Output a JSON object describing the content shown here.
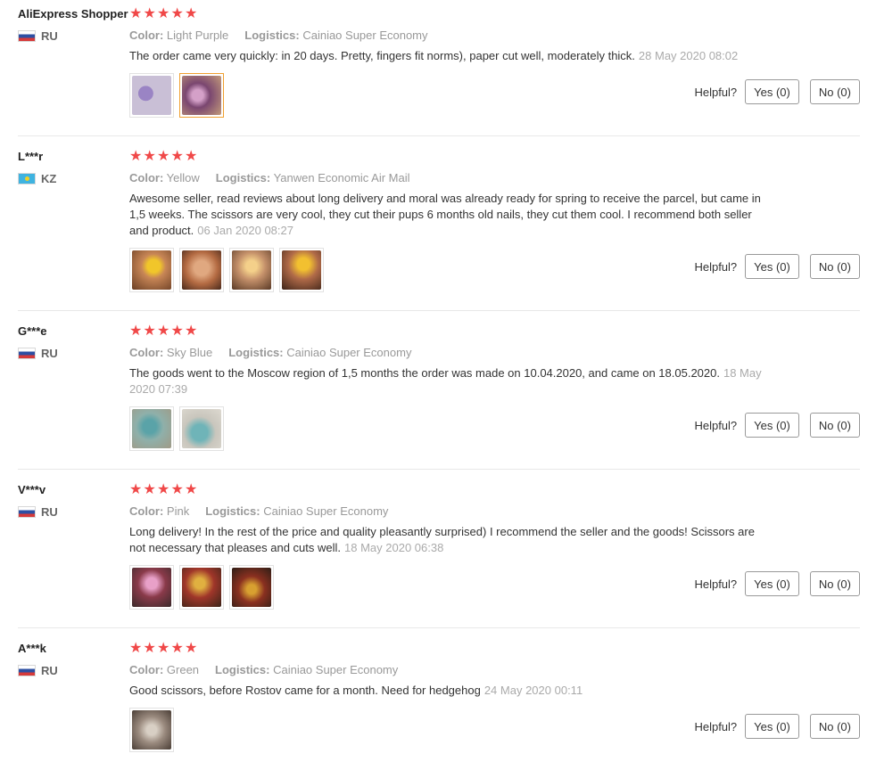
{
  "reviews": [
    {
      "user": "AliExpress Shopper",
      "country": "RU",
      "flag": "ru",
      "stars": 5,
      "color_label": "Color:",
      "color_value": "Light Purple",
      "logistics_label": "Logistics:",
      "logistics_value": "Cainiao Super Economy",
      "text": "The order came very quickly: in 20 days. Pretty, fingers fit norms), paper cut well, moderately thick.",
      "date": "28 May 2020 08:02",
      "photo_colors": [
        "#b9a8cf",
        "#9c6fb0"
      ],
      "helpful_label": "Helpful?",
      "yes_label": "Yes (0)",
      "no_label": "No (0)"
    },
    {
      "user": "L***r",
      "country": "KZ",
      "flag": "kz",
      "stars": 5,
      "color_label": "Color:",
      "color_value": "Yellow",
      "logistics_label": "Logistics:",
      "logistics_value": "Yanwen Economic Air Mail",
      "text": "Awesome seller, read reviews about long delivery and moral was already ready for spring to receive the parcel, but came in 1,5 weeks. The scissors are very cool, they cut their pups 6 months old nails, they cut them cool. I recommend both seller and product.",
      "date": "06 Jan 2020 08:27",
      "photo_colors": [
        "#c87a3c",
        "#c9844e",
        "#b97a4a",
        "#8a5a3c"
      ],
      "helpful_label": "Helpful?",
      "yes_label": "Yes (0)",
      "no_label": "No (0)"
    },
    {
      "user": "G***e",
      "country": "RU",
      "flag": "ru",
      "stars": 5,
      "color_label": "Color:",
      "color_value": "Sky Blue",
      "logistics_label": "Logistics:",
      "logistics_value": "Cainiao Super Economy",
      "text": "The goods went to the Moscow region of 1,5 months the order was made on 10.04.2020, and came on 18.05.2020.",
      "date": "18 May 2020 07:39",
      "photo_colors": [
        "#6f9e96",
        "#7faaa3"
      ],
      "helpful_label": "Helpful?",
      "yes_label": "Yes (0)",
      "no_label": "No (0)"
    },
    {
      "user": "V***v",
      "country": "RU",
      "flag": "ru",
      "stars": 5,
      "color_label": "Color:",
      "color_value": "Pink",
      "logistics_label": "Logistics:",
      "logistics_value": "Cainiao Super Economy",
      "text": "Long delivery! In the rest of the price and quality pleasantly surprised) I recommend the seller and the goods! Scissors are not necessary that pleases and cuts well.",
      "date": "18 May 2020 06:38",
      "photo_colors": [
        "#8a3a4a",
        "#9a3c36",
        "#7a3a2c"
      ],
      "helpful_label": "Helpful?",
      "yes_label": "Yes (0)",
      "no_label": "No (0)"
    },
    {
      "user": "A***k",
      "country": "RU",
      "flag": "ru",
      "stars": 5,
      "color_label": "Color:",
      "color_value": "Green",
      "logistics_label": "Logistics:",
      "logistics_value": "Cainiao Super Economy",
      "text": "Good scissors, before Rostov came for a month. Need for hedgehog",
      "date": "24 May 2020 00:11",
      "photo_colors": [
        "#9a8a7e"
      ],
      "helpful_label": "Helpful?",
      "yes_label": "Yes (0)",
      "no_label": "No (0)"
    }
  ]
}
